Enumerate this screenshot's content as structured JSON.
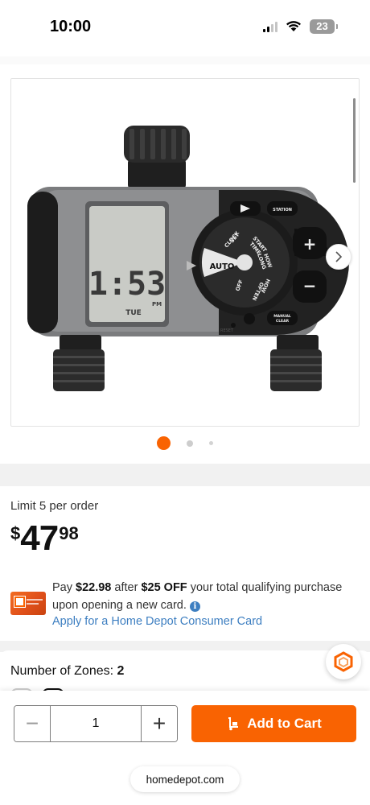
{
  "status_bar": {
    "time": "10:00",
    "battery": "23",
    "icons": [
      "cellular-signal-icon",
      "wifi-icon",
      "battery-icon"
    ]
  },
  "gallery": {
    "image_description_icon": "timer-product-image",
    "timer_display": {
      "time": "1:53",
      "day": "TUE",
      "ampm": "PM"
    },
    "dial_labels": [
      "AUTO",
      "SET CLOCK",
      "START TIME",
      "HOW LONG",
      "HOW OFTEN",
      "OFF"
    ],
    "side_labels": [
      "STATION",
      "MANUAL CLEAR",
      "RESET"
    ],
    "slide_count": 3,
    "active_slide": 1,
    "next_icon": "chevron-right-icon"
  },
  "price": {
    "limit": "Limit 5 per order",
    "currency": "$",
    "dollars": "47",
    "cents": "98"
  },
  "card_offer": {
    "pay_prefix": "Pay ",
    "pay_amount": "$22.98",
    "after_text": " after ",
    "discount": "$25 OFF",
    "rest": " your total qualifying purchase upon opening a new card.",
    "apply_link": "Apply for a Home Depot Consumer Card",
    "info_icon": "info-icon"
  },
  "zones": {
    "label": "Number of Zones: ",
    "value": "2"
  },
  "cart": {
    "quantity": "1",
    "minus": "−",
    "plus": "+",
    "add_to_cart": "Add to Cart",
    "cart_icon": "dolly-cart-icon"
  },
  "browser": {
    "url": "homedepot.com"
  },
  "colors": {
    "brand_orange": "#f96302",
    "link_blue": "#3e7fc1",
    "band_gray": "#f1f1f1"
  }
}
